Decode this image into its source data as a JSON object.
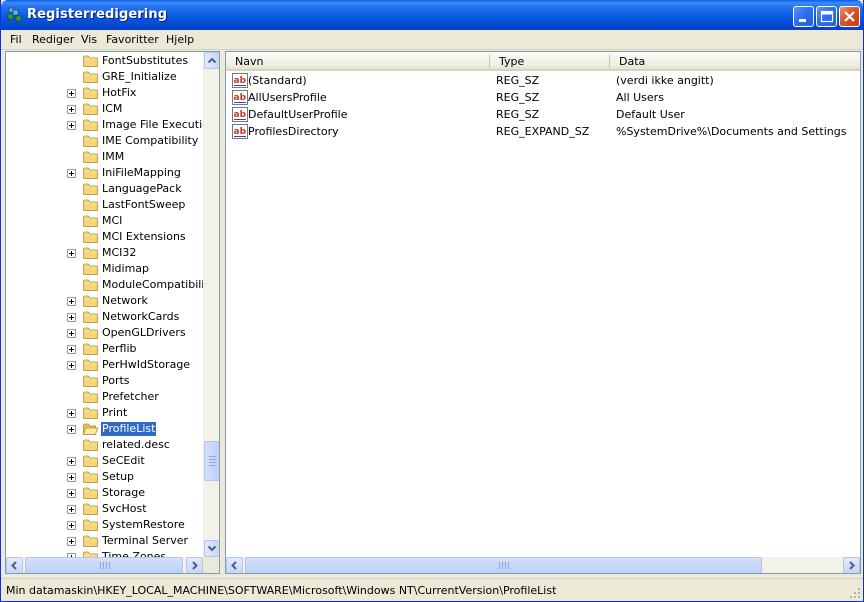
{
  "window": {
    "title": "Registerredigering"
  },
  "menu": [
    {
      "label": "Fil"
    },
    {
      "label": "Rediger"
    },
    {
      "label": "Vis"
    },
    {
      "label": "Favoritter"
    },
    {
      "label": "Hjelp"
    }
  ],
  "tree": {
    "items": [
      {
        "label": "FontSubstitutes",
        "expandable": false
      },
      {
        "label": "GRE_Initialize",
        "expandable": false
      },
      {
        "label": "HotFix",
        "expandable": true
      },
      {
        "label": "ICM",
        "expandable": true
      },
      {
        "label": "Image File Execution",
        "expandable": true
      },
      {
        "label": "IME Compatibility",
        "expandable": false
      },
      {
        "label": "IMM",
        "expandable": false
      },
      {
        "label": "IniFileMapping",
        "expandable": true
      },
      {
        "label": "LanguagePack",
        "expandable": false
      },
      {
        "label": "LastFontSweep",
        "expandable": false
      },
      {
        "label": "MCI",
        "expandable": false
      },
      {
        "label": "MCI Extensions",
        "expandable": false
      },
      {
        "label": "MCI32",
        "expandable": true
      },
      {
        "label": "Midimap",
        "expandable": false
      },
      {
        "label": "ModuleCompatibility",
        "expandable": false
      },
      {
        "label": "Network",
        "expandable": true
      },
      {
        "label": "NetworkCards",
        "expandable": true
      },
      {
        "label": "OpenGLDrivers",
        "expandable": true
      },
      {
        "label": "Perflib",
        "expandable": true
      },
      {
        "label": "PerHwIdStorage",
        "expandable": true
      },
      {
        "label": "Ports",
        "expandable": false
      },
      {
        "label": "Prefetcher",
        "expandable": false
      },
      {
        "label": "Print",
        "expandable": true
      },
      {
        "label": "ProfileList",
        "expandable": true,
        "selected": true
      },
      {
        "label": "related.desc",
        "expandable": false
      },
      {
        "label": "SeCEdit",
        "expandable": true
      },
      {
        "label": "Setup",
        "expandable": true
      },
      {
        "label": "Storage",
        "expandable": true
      },
      {
        "label": "SvcHost",
        "expandable": true
      },
      {
        "label": "SystemRestore",
        "expandable": true
      },
      {
        "label": "Terminal Server",
        "expandable": true
      },
      {
        "label": "Time Zones",
        "expandable": true
      }
    ]
  },
  "list": {
    "columns": [
      {
        "label": "Navn"
      },
      {
        "label": "Type"
      },
      {
        "label": "Data"
      }
    ],
    "rows": [
      {
        "name": "(Standard)",
        "type": "REG_SZ",
        "data": "(verdi ikke angitt)"
      },
      {
        "name": "AllUsersProfile",
        "type": "REG_SZ",
        "data": "All Users"
      },
      {
        "name": "DefaultUserProfile",
        "type": "REG_SZ",
        "data": "Default User"
      },
      {
        "name": "ProfilesDirectory",
        "type": "REG_EXPAND_SZ",
        "data": "%SystemDrive%\\Documents and Settings"
      }
    ]
  },
  "status": {
    "path": "Min datamaskin\\HKEY_LOCAL_MACHINE\\SOFTWARE\\Microsoft\\Windows NT\\CurrentVersion\\ProfileList"
  },
  "icons": {
    "app": "regedit-icon",
    "tree_node": "folder-icon",
    "value": "string-value-icon"
  }
}
